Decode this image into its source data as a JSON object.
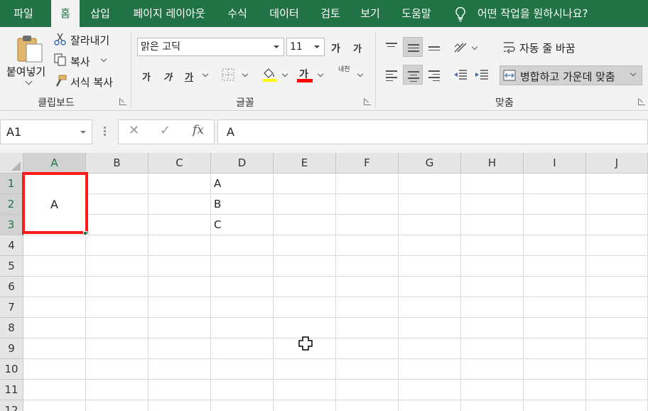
{
  "menu": {
    "tabs": [
      {
        "label": "파일"
      },
      {
        "label": "홈",
        "active": true
      },
      {
        "label": "삽입"
      },
      {
        "label": "페이지 레이아웃"
      },
      {
        "label": "수식"
      },
      {
        "label": "데이터"
      },
      {
        "label": "검토"
      },
      {
        "label": "보기"
      },
      {
        "label": "도움말"
      }
    ],
    "tell_me": "어떤 작업을 원하시나요?"
  },
  "ribbon": {
    "clipboard": {
      "paste": "붙여넣기",
      "cut": "잘라내기",
      "copy": "복사",
      "format_painter": "서식 복사",
      "group_label": "클립보드"
    },
    "font": {
      "font_name": "맑은 고딕",
      "font_size": "11",
      "grow_glyph": "가",
      "shrink_glyph": "가",
      "bold": "가",
      "italic": "가",
      "underline": "가",
      "font_color_glyph": "가",
      "phonetic_glyph": "내천",
      "group_label": "글꼴",
      "fill_color": "#ffff00",
      "font_color": "#ff0000"
    },
    "alignment": {
      "wrap_text": "자동 줄 바꿈",
      "merge_center": "병합하고 가운데 맞춤",
      "group_label": "맞춤"
    }
  },
  "formula_bar": {
    "name_box": "A1",
    "cancel_glyph": "✕",
    "enter_glyph": "✓",
    "fx_glyph": "fx",
    "content": "A"
  },
  "sheet": {
    "columns": [
      "A",
      "B",
      "C",
      "D",
      "E",
      "F",
      "G",
      "H",
      "I",
      "J"
    ],
    "rows": [
      "1",
      "2",
      "3",
      "4",
      "5",
      "6",
      "7",
      "8",
      "9",
      "10",
      "11",
      "12"
    ],
    "merged_A1_A3": "A",
    "d_cells": [
      "A",
      "B",
      "C"
    ]
  }
}
